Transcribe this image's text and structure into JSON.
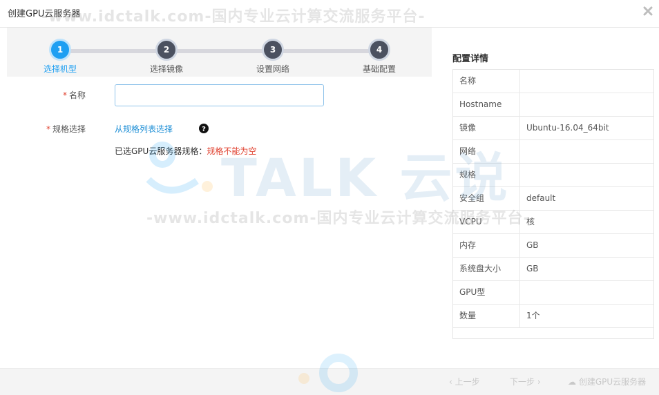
{
  "dialog": {
    "title": "创建GPU云服务器"
  },
  "watermark": {
    "line": "-www.idctalk.com-国内专业云计算交流服务平台-",
    "brand": "TALK 云说"
  },
  "steps": [
    {
      "number": "1",
      "label": "选择机型",
      "active": true
    },
    {
      "number": "2",
      "label": "选择镜像",
      "active": false
    },
    {
      "number": "3",
      "label": "设置网络",
      "active": false
    },
    {
      "number": "4",
      "label": "基础配置",
      "active": false
    }
  ],
  "form": {
    "required_mark": "*",
    "name_label": "名称",
    "name_value": "",
    "spec_label": "规格选择",
    "spec_link": "从规格列表选择",
    "selected_prefix": "已选GPU云服务器规格：",
    "selected_error": "规格不能为空"
  },
  "config": {
    "title": "配置详情",
    "rows": [
      {
        "key": "名称",
        "value": ""
      },
      {
        "key": "Hostname",
        "value": ""
      },
      {
        "key": "镜像",
        "value": "Ubuntu-16.04_64bit"
      },
      {
        "key": "网络",
        "value": ""
      },
      {
        "key": "规格",
        "value": ""
      },
      {
        "key": "安全组",
        "value": "default"
      },
      {
        "key": "VCPU",
        "value": "核"
      },
      {
        "key": "内存",
        "value": "GB"
      },
      {
        "key": "系统盘大小",
        "value": "GB"
      },
      {
        "key": "GPU型",
        "value": ""
      },
      {
        "key": "数量",
        "value": "1个"
      }
    ]
  },
  "footer": {
    "prev_label": "上一步",
    "next_label": "下一步",
    "create_label": "创建GPU云服务器"
  },
  "colors": {
    "accent": "#1e9ff2",
    "error": "#e0412f",
    "step_inactive": "#4b5160"
  }
}
